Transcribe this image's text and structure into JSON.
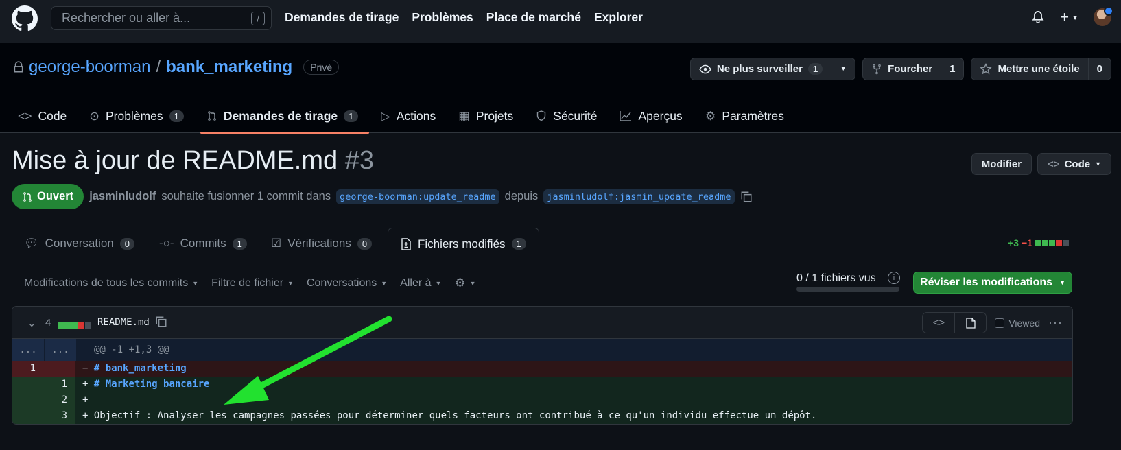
{
  "header": {
    "search_placeholder": "Rechercher ou aller à...",
    "search_shortcut": "/",
    "nav": [
      "Demandes de tirage",
      "Problèmes",
      "Place de marché",
      "Explorer"
    ]
  },
  "repo": {
    "owner": "george-boorman",
    "separator": "/",
    "name": "bank_marketing",
    "visibility": "Privé",
    "watch_label": "Ne plus surveiller",
    "watch_count": "1",
    "fork_label": "Fourcher",
    "fork_count": "1",
    "star_label": "Mettre une étoile",
    "star_count": "0",
    "tabs": [
      {
        "label": "Code",
        "count": ""
      },
      {
        "label": "Problèmes",
        "count": "1"
      },
      {
        "label": "Demandes de tirage",
        "count": "1"
      },
      {
        "label": "Actions",
        "count": ""
      },
      {
        "label": "Projets",
        "count": ""
      },
      {
        "label": "Sécurité",
        "count": ""
      },
      {
        "label": "Aperçus",
        "count": ""
      },
      {
        "label": "Paramètres",
        "count": ""
      }
    ]
  },
  "pr": {
    "title": "Mise à jour de README.md",
    "number": "#3",
    "edit_label": "Modifier",
    "code_label": "Code",
    "state": "Ouvert",
    "author": "jasminludolf",
    "meta_text": "souhaite fusionner 1 commit dans",
    "base_branch": "george-boorman:update_readme",
    "from_text": "depuis",
    "head_branch": "jasminludolf:jasmin_update_readme",
    "tabs": [
      {
        "label": "Conversation",
        "count": "0"
      },
      {
        "label": "Commits",
        "count": "1"
      },
      {
        "label": "Vérifications",
        "count": "0"
      },
      {
        "label": "Fichiers modifiés",
        "count": "1"
      }
    ],
    "additions": "+3",
    "deletions": "−1"
  },
  "toolbar": {
    "all_commits": "Modifications de tous les commits",
    "file_filter": "Filtre de fichier",
    "conversations": "Conversations",
    "jump_to": "Aller à",
    "files_viewed": "0 / 1 fichiers vus",
    "review_label": "Réviser les modifications"
  },
  "file": {
    "changes": "4",
    "name": "README.md",
    "viewed_label": "Viewed",
    "hunk_left": "...",
    "hunk_right": "...",
    "hunk_header": "@@ -1 +1,3 @@",
    "lines": [
      {
        "type": "del",
        "old": "1",
        "new": "",
        "sign": "−",
        "text": "# bank_marketing"
      },
      {
        "type": "add",
        "old": "",
        "new": "1",
        "sign": "+",
        "text": "# Marketing bancaire"
      },
      {
        "type": "add",
        "old": "",
        "new": "2",
        "sign": "+",
        "text": ""
      },
      {
        "type": "add",
        "old": "",
        "new": "3",
        "sign": "+",
        "text": "Objectif : Analyser les campagnes passées pour déterminer quels facteurs ont contribué à ce qu'un individu effectue un dépôt."
      }
    ]
  },
  "colors": {
    "accent": "#f78166",
    "green": "#238636",
    "link": "#58a6ff",
    "annotation_arrow": "#22e12f"
  }
}
